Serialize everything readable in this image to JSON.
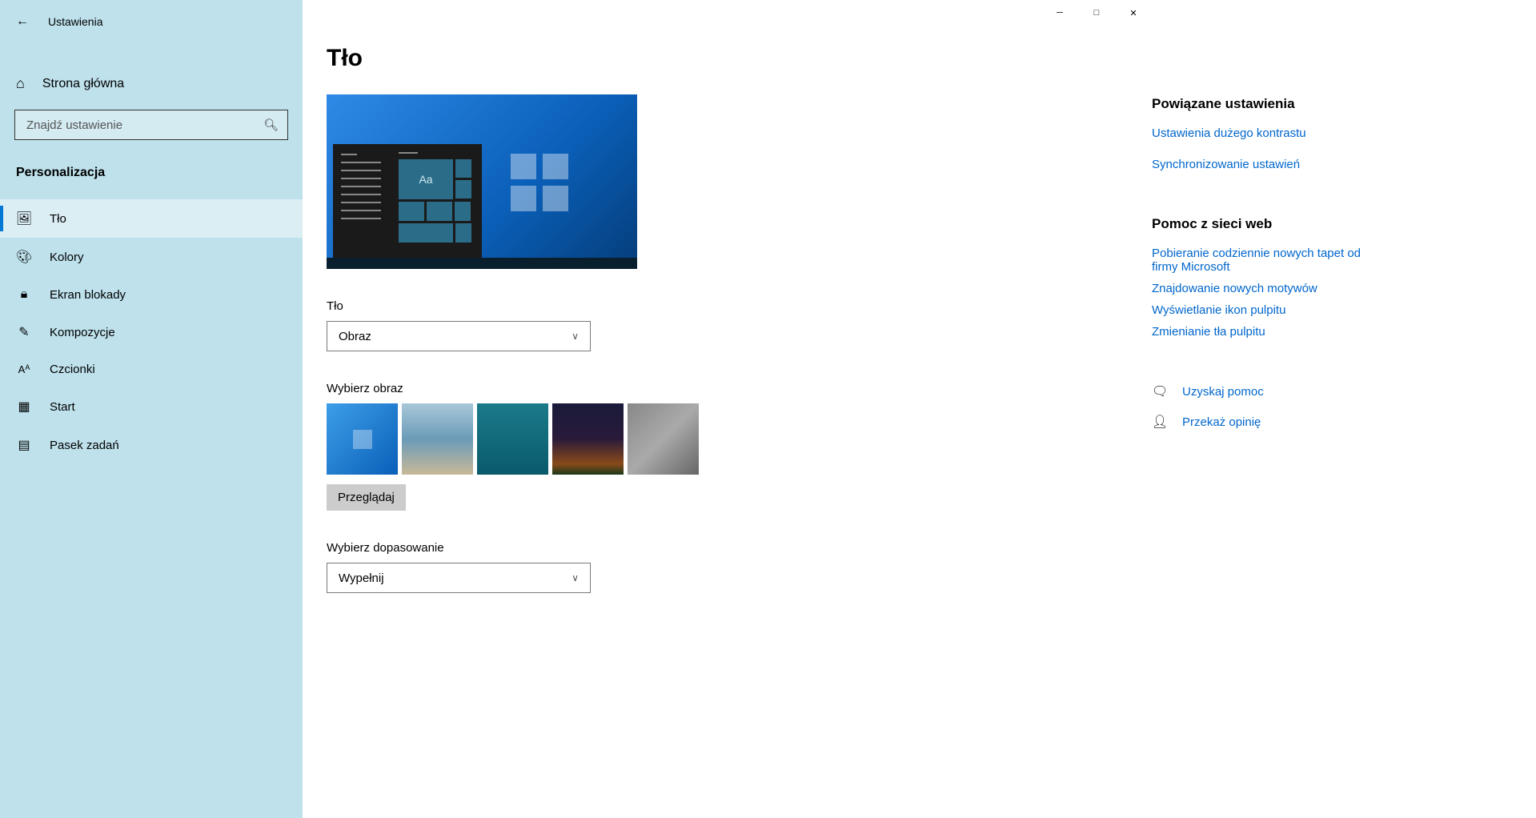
{
  "app_title": "Ustawienia",
  "home_label": "Strona główna",
  "search": {
    "placeholder": "Znajdź ustawienie"
  },
  "category": "Personalizacja",
  "nav": [
    {
      "label": "Tło",
      "active": true
    },
    {
      "label": "Kolory",
      "active": false
    },
    {
      "label": "Ekran blokady",
      "active": false
    },
    {
      "label": "Kompozycje",
      "active": false
    },
    {
      "label": "Czcionki",
      "active": false
    },
    {
      "label": "Start",
      "active": false
    },
    {
      "label": "Pasek zadań",
      "active": false
    }
  ],
  "page": {
    "title": "Tło",
    "preview_sample_text": "Aa",
    "bg_label": "Tło",
    "bg_value": "Obraz",
    "choose_image_label": "Wybierz obraz",
    "browse_label": "Przeglądaj",
    "fit_label": "Wybierz dopasowanie",
    "fit_value": "Wypełnij"
  },
  "related": {
    "heading": "Powiązane ustawienia",
    "links": [
      "Ustawienia dużego kontrastu",
      "Synchronizowanie ustawień"
    ]
  },
  "web_help": {
    "heading": "Pomoc z sieci web",
    "links": [
      "Pobieranie codziennie nowych tapet od firmy Microsoft",
      "Znajdowanie nowych motywów",
      "Wyświetlanie ikon pulpitu",
      "Zmienianie tła pulpitu"
    ]
  },
  "actions": {
    "get_help": "Uzyskaj pomoc",
    "feedback": "Przekaż opinię"
  }
}
